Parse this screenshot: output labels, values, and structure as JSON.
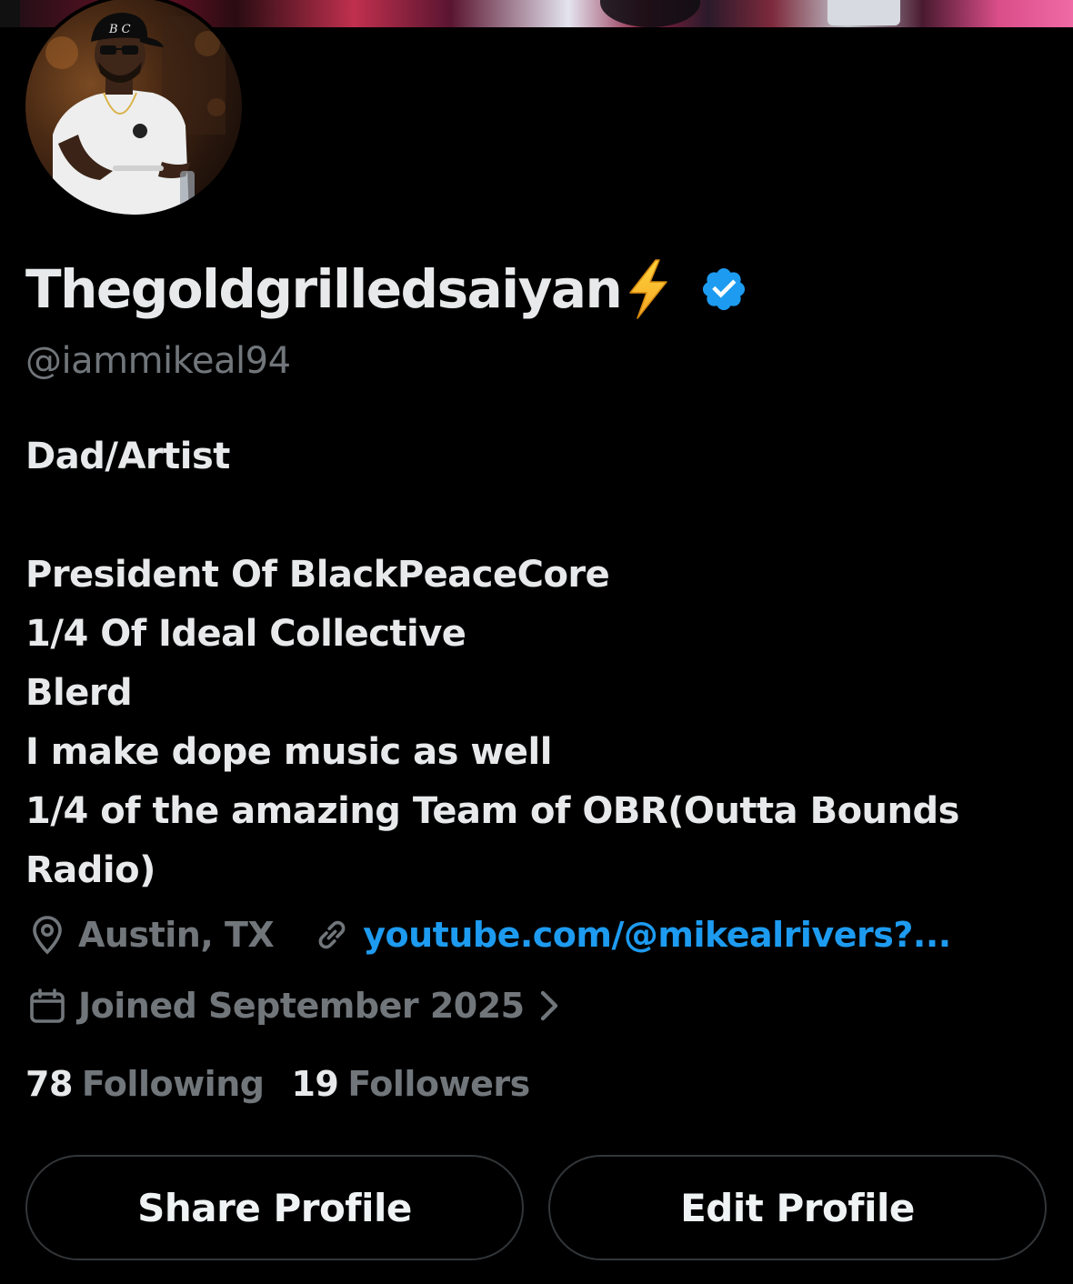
{
  "profile": {
    "display_name": "Thegoldgrilledsaiyan",
    "handle": "@iammikeal94",
    "verified": true,
    "name_emoji": "high-voltage-emoji",
    "avatar_hat_text": "B C"
  },
  "bio": {
    "lines": [
      "Dad/Artist",
      "",
      "President Of BlackPeaceCore",
      "1/4 Of Ideal Collective",
      "Blerd",
      "I make dope music as well",
      "1/4 of the amazing Team of OBR(Outta Bounds",
      "Radio)"
    ]
  },
  "meta": {
    "location": "Austin, TX",
    "link": "youtube.com/@mikealrivers?...",
    "joined": "Joined September 2025"
  },
  "stats": {
    "following_count": "78",
    "following_label": "Following",
    "followers_count": "19",
    "followers_label": "Followers"
  },
  "actions": {
    "share_label": "Share Profile",
    "edit_label": "Edit Profile"
  },
  "colors": {
    "background": "#000000",
    "primary_text": "#e7e9ea",
    "secondary_text": "#71767b",
    "link": "#1d9bf0",
    "verified_badge": "#1d9bf0",
    "button_border": "#333639"
  },
  "icons": {
    "location": "location-pin-icon",
    "link": "link-icon",
    "calendar": "calendar-icon",
    "chevron": "chevron-right-icon",
    "verified": "verified-badge-icon"
  }
}
